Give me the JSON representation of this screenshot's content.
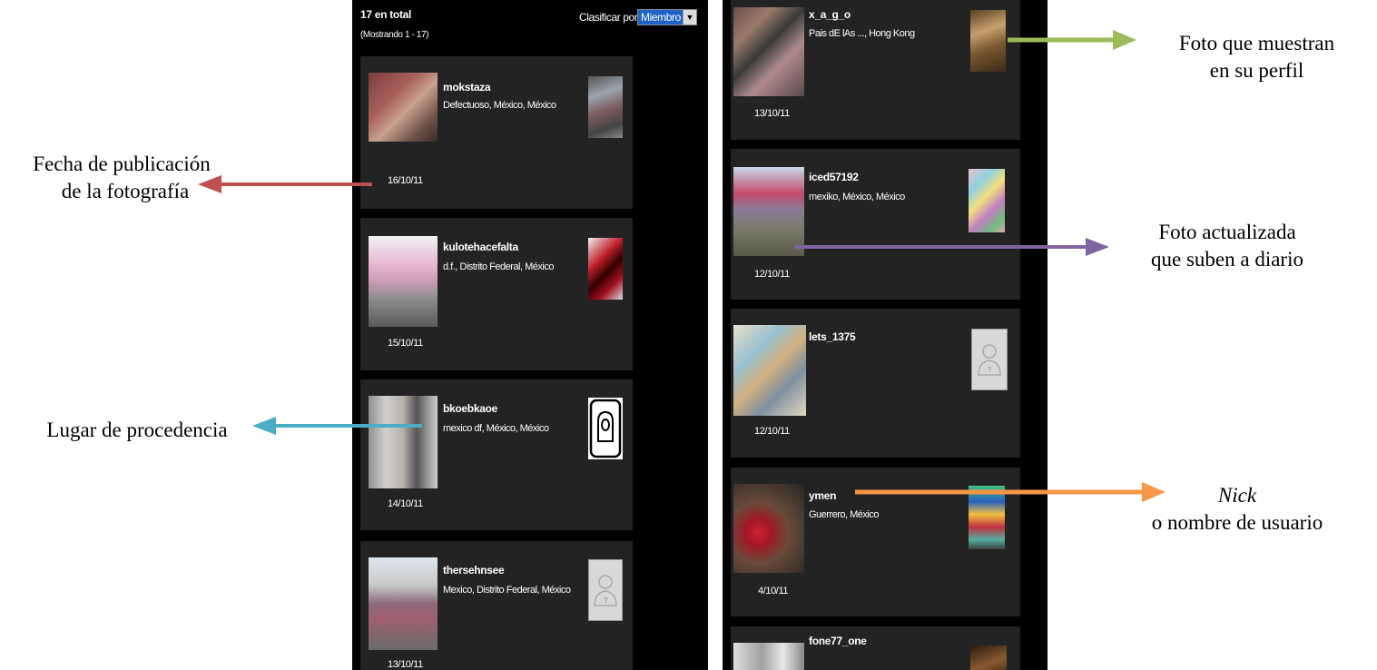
{
  "left_panel": {
    "total": "17 en total",
    "showing": "(Mostrando 1 - 17)",
    "sort_label": "Clasificar por:",
    "sort_value": "Miembro",
    "cards": [
      {
        "nick": "mokstaza",
        "location": "Defectuoso, México, México",
        "date": "16/10/11"
      },
      {
        "nick": "kulotehacefalta",
        "location": "d.f., Distrito Federal, México",
        "date": "15/10/11"
      },
      {
        "nick": "bkoebkaoe",
        "location": "mexico df, México, México",
        "date": "14/10/11"
      },
      {
        "nick": "thersehnsee",
        "location": "Mexico, Distrito Federal, México",
        "date": "13/10/11"
      }
    ]
  },
  "right_panel": {
    "cards": [
      {
        "nick": "x_a_g_o",
        "location": "Pais dE lAs ..., Hong Kong",
        "date": "13/10/11"
      },
      {
        "nick": "iced57192",
        "location": "mexiko, México, México",
        "date": "12/10/11"
      },
      {
        "nick": "lets_1375",
        "location": "",
        "date": "12/10/11"
      },
      {
        "nick": "ymen",
        "location": "Guerrero, México",
        "date": "4/10/11"
      },
      {
        "nick": "fone77_one",
        "location": "",
        "date": ""
      }
    ]
  },
  "annotations": {
    "fecha_line1": "Fecha de publicación",
    "fecha_line2": "de la fotografía",
    "lugar": "Lugar de procedencia",
    "perfil_line1": "Foto que muestran",
    "perfil_line2": "en su perfil",
    "actualizada_line1": "Foto actualizada",
    "actualizada_line2": "que suben a diario",
    "nick_line1": "Nick",
    "nick_line2": "o nombre de usuario"
  },
  "colors": {
    "arrow_fecha": "#c0504d",
    "arrow_lugar": "#4bacc6",
    "arrow_perfil": "#9bbb59",
    "arrow_actualizada": "#8064a2",
    "arrow_nick": "#f79646",
    "card_bg": "#232323",
    "panel_bg": "#000000"
  }
}
